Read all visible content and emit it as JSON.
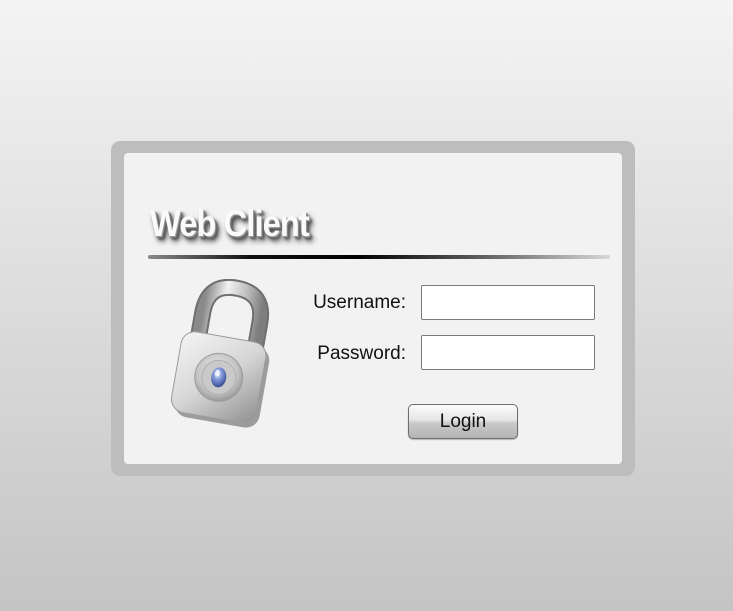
{
  "login_panel": {
    "title": "Web Client",
    "username_label": "Username:",
    "username_value": "",
    "password_label": "Password:",
    "password_value": "",
    "login_button_label": "Login",
    "lock_icon": "padlock-icon"
  },
  "colors": {
    "panel_frame": "#bdbdbd",
    "panel_fill": "#f2f2f2",
    "lock_accent": "#5b74b8"
  }
}
